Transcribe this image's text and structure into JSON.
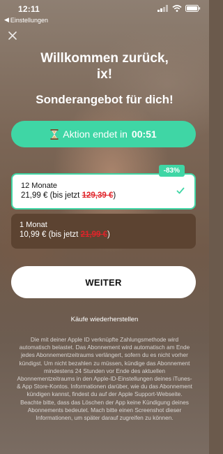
{
  "status_bar": {
    "time": "12:11",
    "back_label": "Einstellungen",
    "icons": [
      "signal-icon",
      "wifi-icon",
      "battery-icon"
    ]
  },
  "header": {
    "title_line1": "Willkommen zurück,",
    "title_line2": "ix!",
    "subtitle": "Sonderangebot für dich!"
  },
  "promo": {
    "icon": "hourglass-icon",
    "label": "Aktion endet in",
    "countdown": "00:51",
    "color": "#3fd6a5"
  },
  "plans": [
    {
      "name": "12 Monate",
      "price": "21,99 € (bis jetzt",
      "old_price": "129,39 €",
      "suffix": ")",
      "badge": "-83%",
      "selected": true
    },
    {
      "name": "1 Monat",
      "price": "10,99 € (bis jetzt",
      "old_price": "21,99 €",
      "suffix": ")",
      "selected": false
    }
  ],
  "actions": {
    "continue_label": "WEITER",
    "restore_label": "Käufe wiederherstellen"
  },
  "legal_text": "Die mit deiner Apple ID verknüpfte Zahlungsmethode wird automatisch belastet. Das Abonnement wird automatisch am Ende jedes Abonnementzeitraums verlängert, sofern du es nicht vorher kündigst. Um nicht bezahlen zu müssen, kündige das Abonnement mindestens 24 Stunden vor Ende des aktuellen Abonnementzeitraums in den Apple-ID-Einstellungen deines iTunes- & App Store-Kontos. Informationen darüber, wie du das Abonnement kündigen kannst, findest du auf der Apple Support-Webseite. Beachte bitte, dass das Löschen der App keine Kündigung deines Abonnements bedeutet. Mach bitte einen Screenshot dieser Informationen, um später darauf zugreifen zu können."
}
